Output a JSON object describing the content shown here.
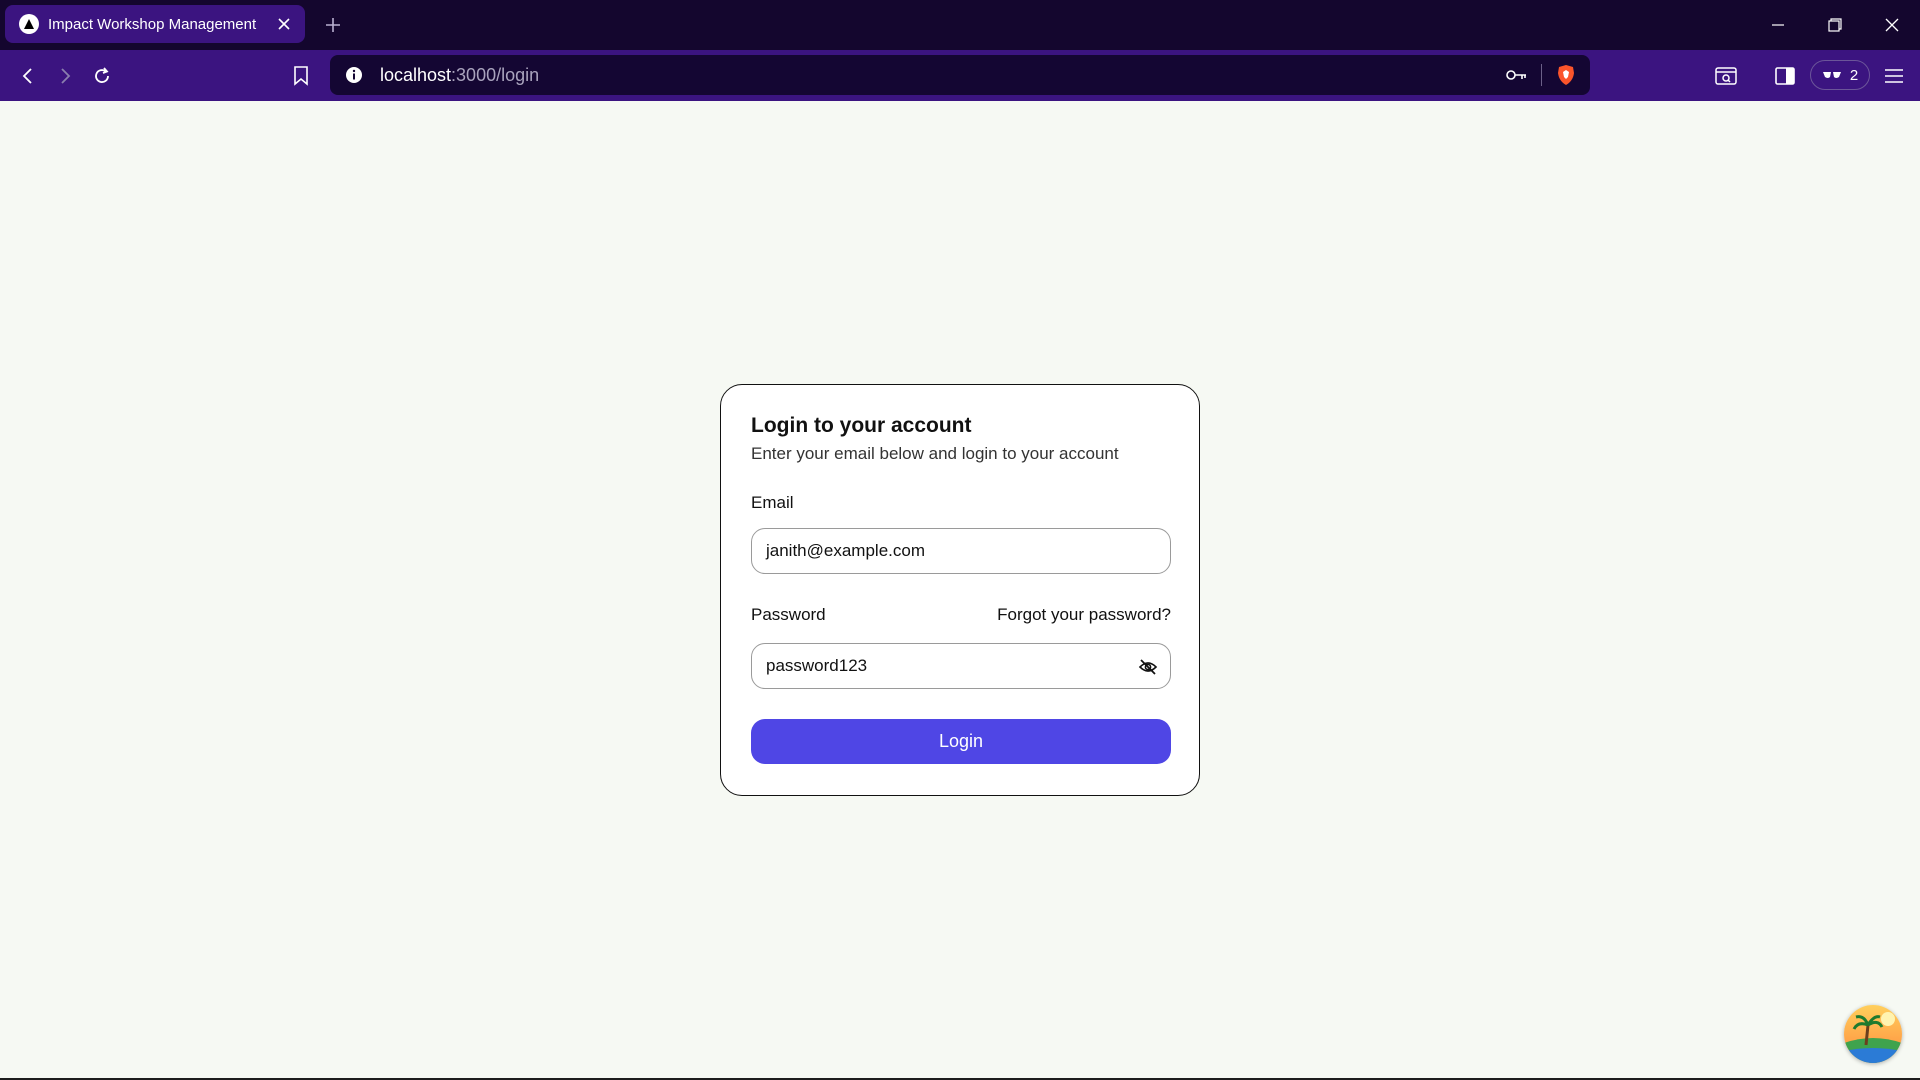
{
  "browser": {
    "tab": {
      "title": "Impact Workshop Management"
    },
    "url": {
      "host": "localhost",
      "path": ":3000/login"
    },
    "wallet_count": "2",
    "icons": {
      "favicon": "triangle-logo-icon",
      "close": "close-icon",
      "new_tab": "plus-icon",
      "back": "arrow-left-icon",
      "forward": "arrow-right-icon",
      "reload": "reload-icon",
      "bookmark": "bookmark-icon",
      "site_info": "info-icon",
      "password_key": "key-icon",
      "brave_shield": "brave-shield-icon",
      "screenshot": "screenshot-icon",
      "sidebar": "sidebar-icon",
      "wallet": "wallet-icon",
      "menu": "hamburger-menu-icon"
    },
    "colors": {
      "titlebar": "#14062e",
      "toolbar": "#3b1480",
      "urlbar": "#140633"
    }
  },
  "login": {
    "title": "Login to your account",
    "subtitle": "Enter your email below and login to your account",
    "email": {
      "label": "Email",
      "value": "janith@example.com"
    },
    "password": {
      "label": "Password",
      "value": "password123",
      "forgot_label": "Forgot your password?",
      "toggle_icon": "eye-off-icon"
    },
    "submit_label": "Login",
    "colors": {
      "page_bg": "#f6f9f3",
      "button": "#4f46e5"
    }
  }
}
